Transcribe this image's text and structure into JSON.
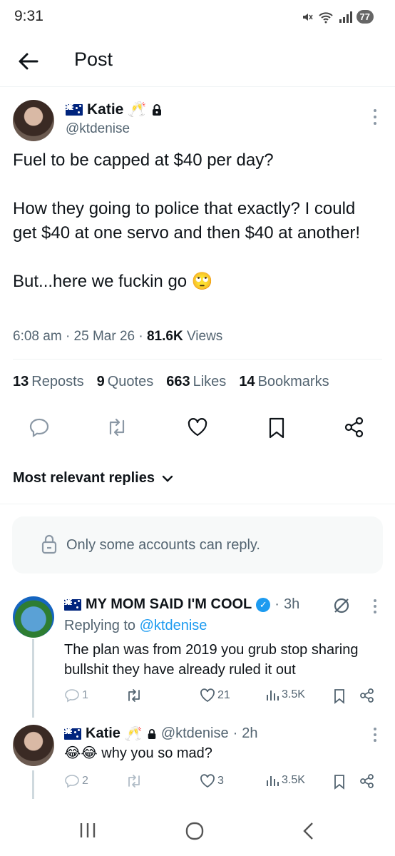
{
  "status_bar": {
    "time": "9:31",
    "battery": "77"
  },
  "header": {
    "title": "Post"
  },
  "post": {
    "author_name": "Katie",
    "author_emoji": "🥂",
    "handle": "@ktdenise",
    "text": "Fuel to be capped at $40 per day?\n\nHow they going to police that exactly?  I could get $40 at one servo and then $40 at another!\n\nBut...here we fuckin go 🙄",
    "time": "6:08 am",
    "date": "25 Mar 26",
    "views_count": "81.6K",
    "views_label": "Views"
  },
  "stats": {
    "reposts_count": "13",
    "reposts_label": "Reposts",
    "quotes_count": "9",
    "quotes_label": "Quotes",
    "likes_count": "663",
    "likes_label": "Likes",
    "bookmarks_count": "14",
    "bookmarks_label": "Bookmarks"
  },
  "replies_filter": {
    "label": "Most relevant replies"
  },
  "reply_notice": {
    "text": "Only some accounts can reply."
  },
  "replies": [
    {
      "name": "MY MOM SAID I'M COOL",
      "time": "3h",
      "replying_prefix": "Replying to",
      "replying_handle": "@ktdenise",
      "text": "The plan was from 2019 you grub stop sharing bullshit they have already ruled it out",
      "reply_count": "1",
      "like_count": "21",
      "view_count": "3.5K"
    },
    {
      "name": "Katie",
      "emoji": "🥂",
      "handle": "@ktdenise",
      "time": "2h",
      "text": "😂😂 why you so mad?",
      "reply_count": "2",
      "like_count": "3",
      "view_count": "3.5K"
    }
  ],
  "colors": {
    "accent": "#1d9bf0",
    "secondary_text": "#536471",
    "primary_text": "#0f1419"
  }
}
